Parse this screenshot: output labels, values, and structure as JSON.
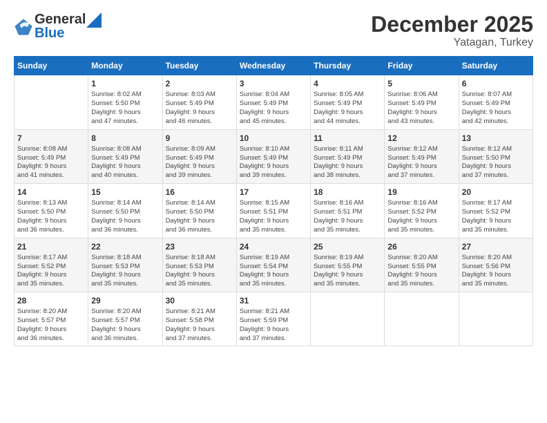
{
  "header": {
    "logo_general": "General",
    "logo_blue": "Blue",
    "title": "December 2025",
    "subtitle": "Yatagan, Turkey"
  },
  "days_of_week": [
    "Sunday",
    "Monday",
    "Tuesday",
    "Wednesday",
    "Thursday",
    "Friday",
    "Saturday"
  ],
  "weeks": [
    [
      {
        "day": "",
        "info": ""
      },
      {
        "day": "1",
        "info": "Sunrise: 8:02 AM\nSunset: 5:50 PM\nDaylight: 9 hours\nand 47 minutes."
      },
      {
        "day": "2",
        "info": "Sunrise: 8:03 AM\nSunset: 5:49 PM\nDaylight: 9 hours\nand 46 minutes."
      },
      {
        "day": "3",
        "info": "Sunrise: 8:04 AM\nSunset: 5:49 PM\nDaylight: 9 hours\nand 45 minutes."
      },
      {
        "day": "4",
        "info": "Sunrise: 8:05 AM\nSunset: 5:49 PM\nDaylight: 9 hours\nand 44 minutes."
      },
      {
        "day": "5",
        "info": "Sunrise: 8:06 AM\nSunset: 5:49 PM\nDaylight: 9 hours\nand 43 minutes."
      },
      {
        "day": "6",
        "info": "Sunrise: 8:07 AM\nSunset: 5:49 PM\nDaylight: 9 hours\nand 42 minutes."
      }
    ],
    [
      {
        "day": "7",
        "info": "Sunrise: 8:08 AM\nSunset: 5:49 PM\nDaylight: 9 hours\nand 41 minutes."
      },
      {
        "day": "8",
        "info": "Sunrise: 8:08 AM\nSunset: 5:49 PM\nDaylight: 9 hours\nand 40 minutes."
      },
      {
        "day": "9",
        "info": "Sunrise: 8:09 AM\nSunset: 5:49 PM\nDaylight: 9 hours\nand 39 minutes."
      },
      {
        "day": "10",
        "info": "Sunrise: 8:10 AM\nSunset: 5:49 PM\nDaylight: 9 hours\nand 39 minutes."
      },
      {
        "day": "11",
        "info": "Sunrise: 8:11 AM\nSunset: 5:49 PM\nDaylight: 9 hours\nand 38 minutes."
      },
      {
        "day": "12",
        "info": "Sunrise: 8:12 AM\nSunset: 5:49 PM\nDaylight: 9 hours\nand 37 minutes."
      },
      {
        "day": "13",
        "info": "Sunrise: 8:12 AM\nSunset: 5:50 PM\nDaylight: 9 hours\nand 37 minutes."
      }
    ],
    [
      {
        "day": "14",
        "info": "Sunrise: 8:13 AM\nSunset: 5:50 PM\nDaylight: 9 hours\nand 36 minutes."
      },
      {
        "day": "15",
        "info": "Sunrise: 8:14 AM\nSunset: 5:50 PM\nDaylight: 9 hours\nand 36 minutes."
      },
      {
        "day": "16",
        "info": "Sunrise: 8:14 AM\nSunset: 5:50 PM\nDaylight: 9 hours\nand 36 minutes."
      },
      {
        "day": "17",
        "info": "Sunrise: 8:15 AM\nSunset: 5:51 PM\nDaylight: 9 hours\nand 35 minutes."
      },
      {
        "day": "18",
        "info": "Sunrise: 8:16 AM\nSunset: 5:51 PM\nDaylight: 9 hours\nand 35 minutes."
      },
      {
        "day": "19",
        "info": "Sunrise: 8:16 AM\nSunset: 5:52 PM\nDaylight: 9 hours\nand 35 minutes."
      },
      {
        "day": "20",
        "info": "Sunrise: 8:17 AM\nSunset: 5:52 PM\nDaylight: 9 hours\nand 35 minutes."
      }
    ],
    [
      {
        "day": "21",
        "info": "Sunrise: 8:17 AM\nSunset: 5:52 PM\nDaylight: 9 hours\nand 35 minutes."
      },
      {
        "day": "22",
        "info": "Sunrise: 8:18 AM\nSunset: 5:53 PM\nDaylight: 9 hours\nand 35 minutes."
      },
      {
        "day": "23",
        "info": "Sunrise: 8:18 AM\nSunset: 5:53 PM\nDaylight: 9 hours\nand 35 minutes."
      },
      {
        "day": "24",
        "info": "Sunrise: 8:19 AM\nSunset: 5:54 PM\nDaylight: 9 hours\nand 35 minutes."
      },
      {
        "day": "25",
        "info": "Sunrise: 8:19 AM\nSunset: 5:55 PM\nDaylight: 9 hours\nand 35 minutes."
      },
      {
        "day": "26",
        "info": "Sunrise: 8:20 AM\nSunset: 5:55 PM\nDaylight: 9 hours\nand 35 minutes."
      },
      {
        "day": "27",
        "info": "Sunrise: 8:20 AM\nSunset: 5:56 PM\nDaylight: 9 hours\nand 35 minutes."
      }
    ],
    [
      {
        "day": "28",
        "info": "Sunrise: 8:20 AM\nSunset: 5:57 PM\nDaylight: 9 hours\nand 36 minutes."
      },
      {
        "day": "29",
        "info": "Sunrise: 8:20 AM\nSunset: 5:57 PM\nDaylight: 9 hours\nand 36 minutes."
      },
      {
        "day": "30",
        "info": "Sunrise: 8:21 AM\nSunset: 5:58 PM\nDaylight: 9 hours\nand 37 minutes."
      },
      {
        "day": "31",
        "info": "Sunrise: 8:21 AM\nSunset: 5:59 PM\nDaylight: 9 hours\nand 37 minutes."
      },
      {
        "day": "",
        "info": ""
      },
      {
        "day": "",
        "info": ""
      },
      {
        "day": "",
        "info": ""
      }
    ]
  ]
}
